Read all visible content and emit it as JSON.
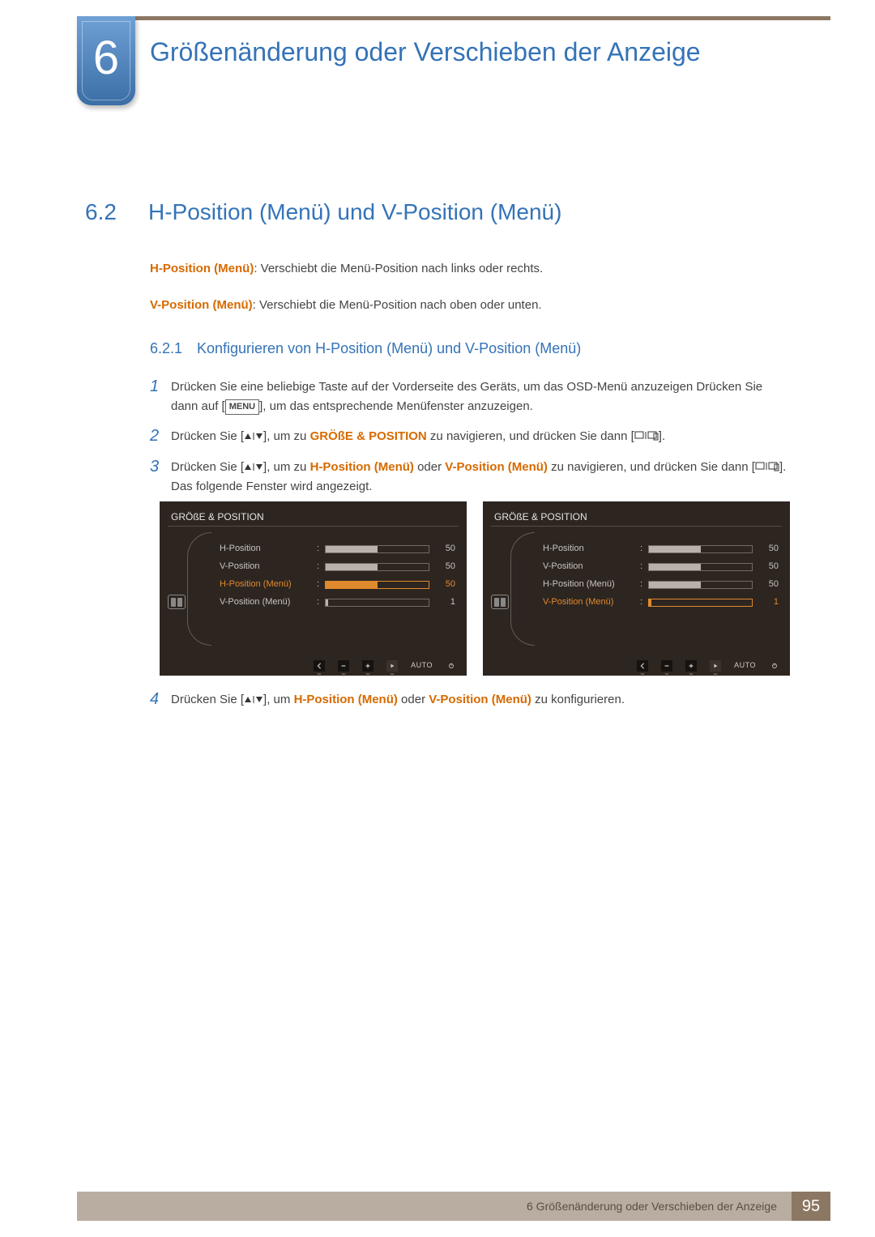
{
  "chapter": {
    "number": "6",
    "title": "Größenänderung oder Verschieben der Anzeige"
  },
  "section": {
    "number": "6.2",
    "title": "H-Position (Menü) und V-Position (Menü)"
  },
  "descriptions": {
    "h_menu_label": "H-Position (Menü)",
    "h_menu_text": ": Verschiebt die Menü-Position nach links oder rechts.",
    "v_menu_label": "V-Position (Menü)",
    "v_menu_text": ": Verschiebt die Menü-Position nach oben oder unten."
  },
  "subsection": {
    "number": "6.2.1",
    "title": "Konfigurieren von H-Position (Menü) und V-Position (Menü)"
  },
  "steps": {
    "s1a": "Drücken Sie eine beliebige Taste auf der Vorderseite des Geräts, um das OSD-Menü anzuzeigen Drücken Sie dann auf [",
    "s1_menu": "MENU",
    "s1b": "], um das entsprechende Menüfenster anzuzeigen.",
    "s2a": "Drücken Sie [",
    "s2b": "], um zu ",
    "s2_target": "GRÖßE & POSITION",
    "s2c": " zu navigieren, und drücken Sie dann [",
    "s2d": "].",
    "s3a": "Drücken Sie [",
    "s3b": "], um zu ",
    "s3_h": "H-Position (Menü)",
    "s3_oder": " oder ",
    "s3_v": "V-Position (Menü)",
    "s3c": " zu navigieren, und drücken Sie dann [",
    "s3d": "]. Das folgende Fenster wird angezeigt.",
    "s4a": "Drücken Sie [",
    "s4b": "], um ",
    "s4_h": "H-Position (Menü)",
    "s4_oder": " oder ",
    "s4_v": "V-Position (Menü)",
    "s4c": " zu konfigurieren."
  },
  "osd": {
    "title": "GRÖßE & POSITION",
    "items": [
      {
        "label": "H-Position",
        "value": "50",
        "fill": 50
      },
      {
        "label": "V-Position",
        "value": "50",
        "fill": 50
      },
      {
        "label": "H-Position (Menü)",
        "value": "50",
        "fill": 50
      },
      {
        "label": "V-Position (Menü)",
        "value": "1",
        "fill": 2
      }
    ],
    "auto": "AUTO",
    "left_selected_index": 2,
    "right_selected_index": 3
  },
  "footer": {
    "label": "6 Größenänderung oder Verschieben der Anzeige",
    "page": "95"
  }
}
